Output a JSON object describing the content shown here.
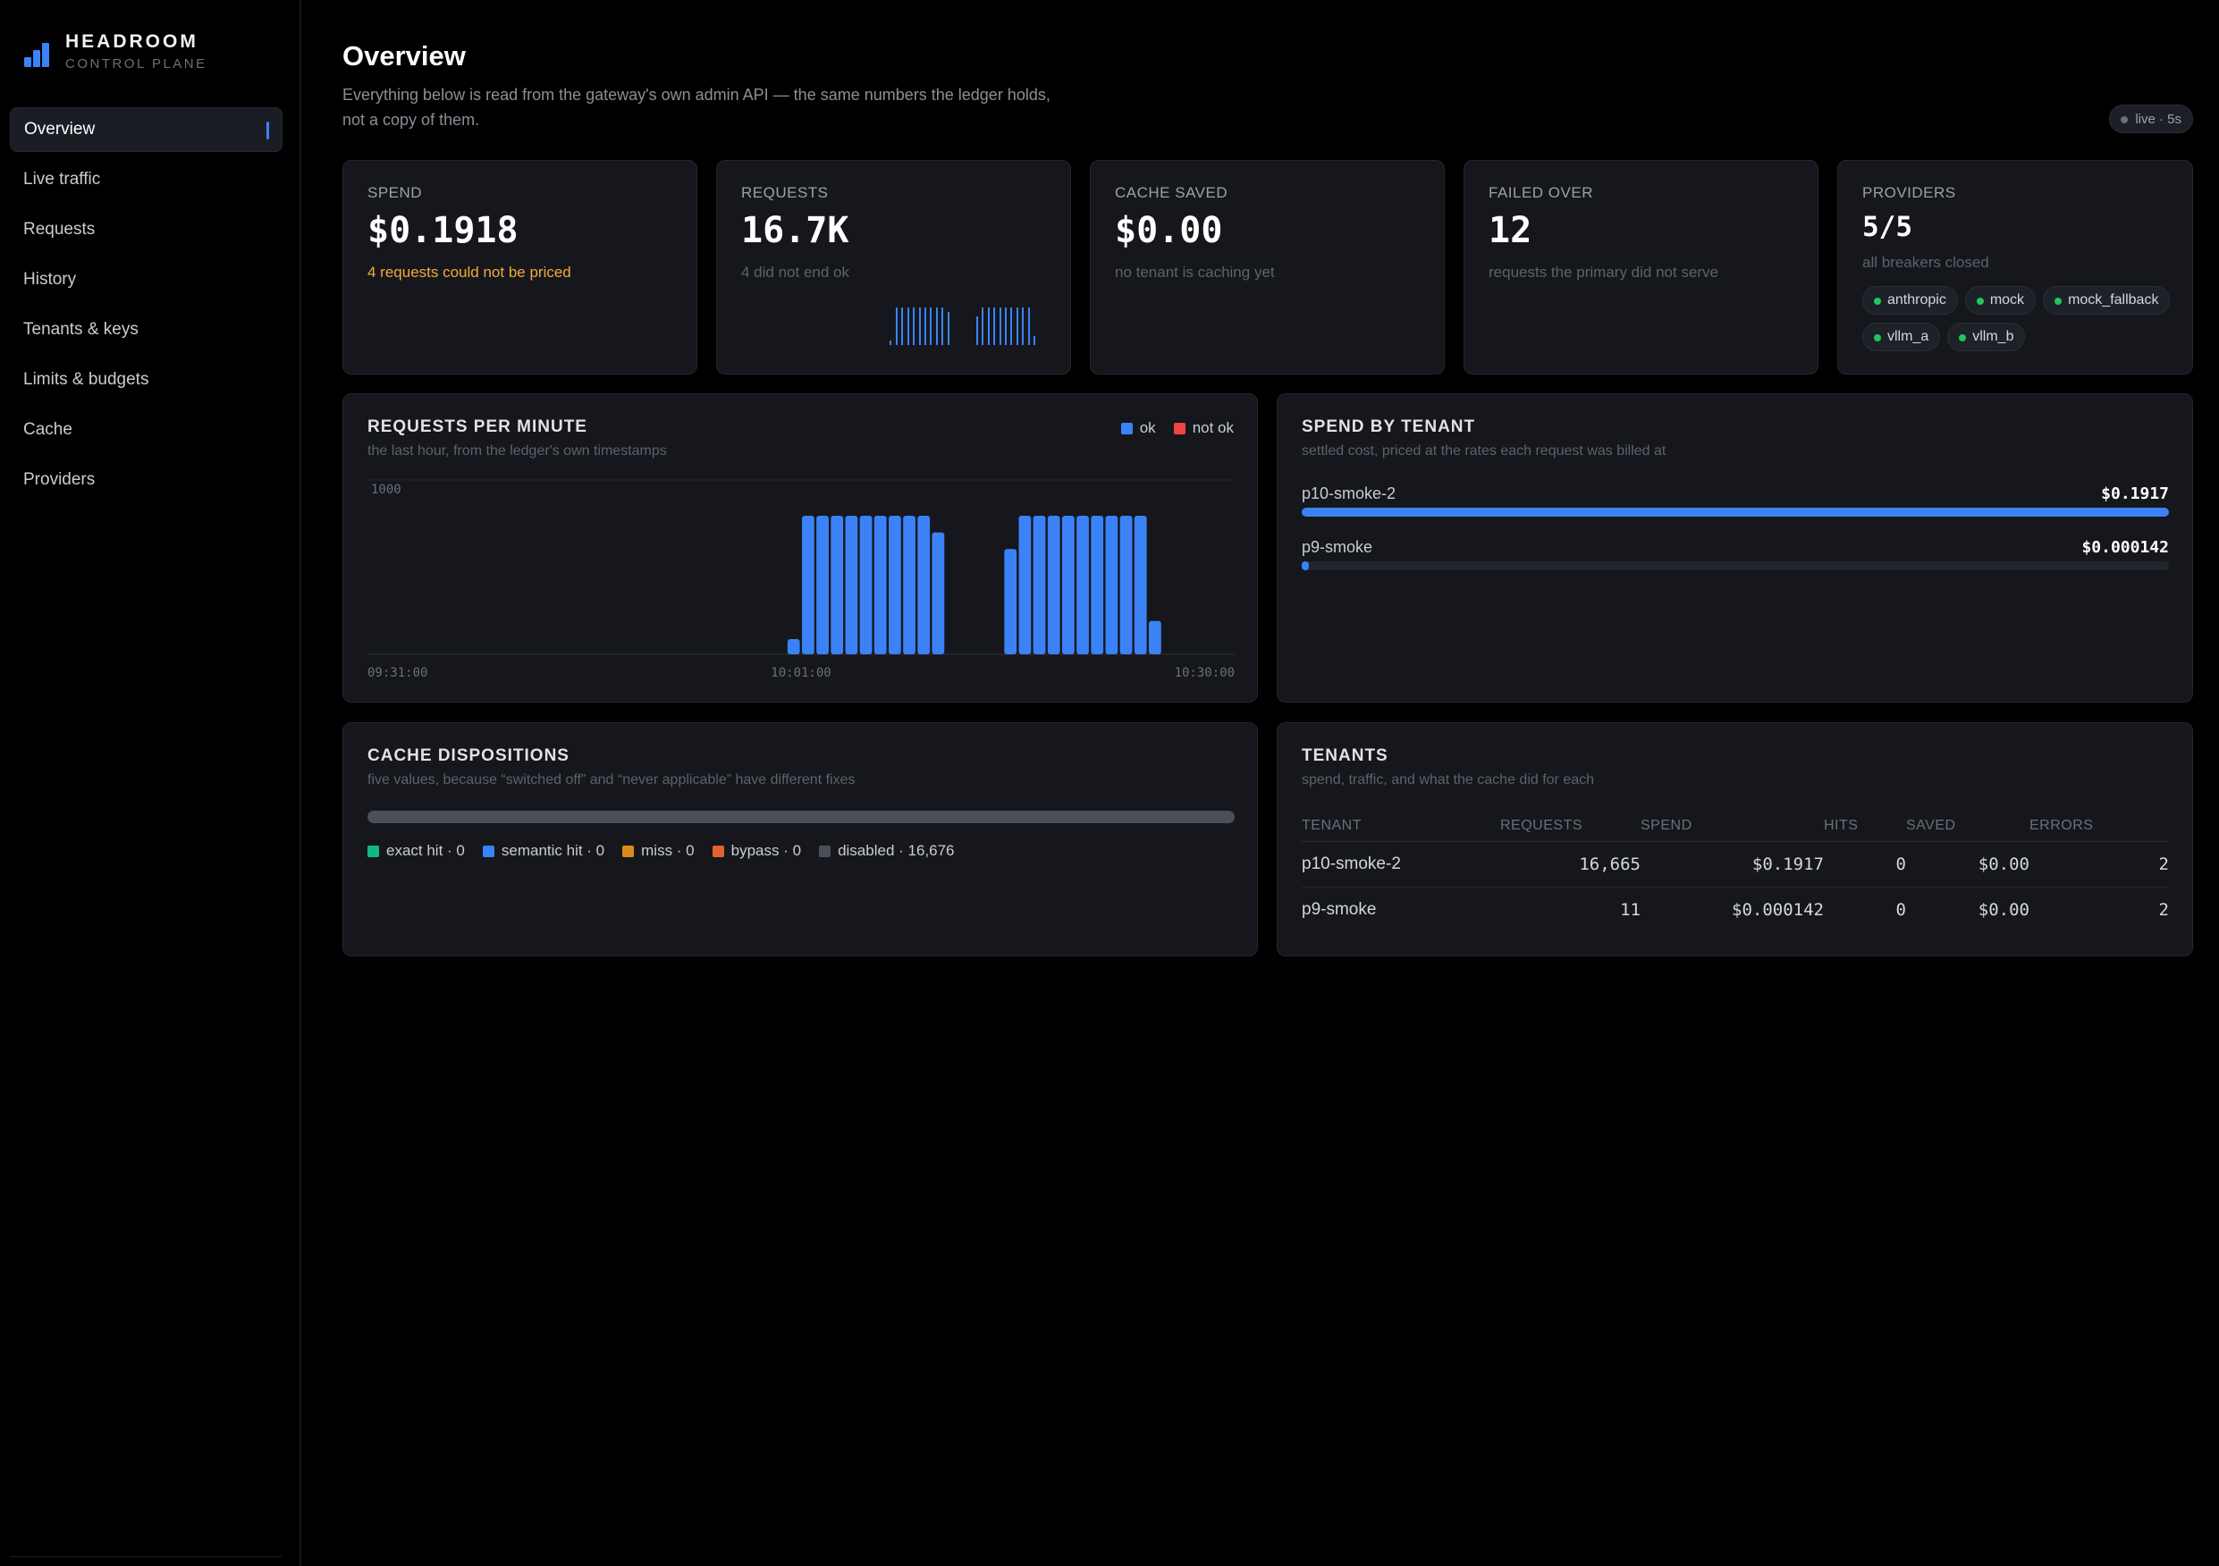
{
  "brand": {
    "name": "HEADROOM",
    "subtitle": "CONTROL PLANE",
    "icon": "bar-chart-icon"
  },
  "nav": {
    "items": [
      {
        "label": "Overview",
        "active": true
      },
      {
        "label": "Live traffic"
      },
      {
        "label": "Requests"
      },
      {
        "label": "History"
      },
      {
        "label": "Tenants & keys"
      },
      {
        "label": "Limits & budgets"
      },
      {
        "label": "Cache"
      },
      {
        "label": "Providers"
      }
    ]
  },
  "header": {
    "title": "Overview",
    "subtitle": "Everything below is read from the gateway's own admin API — the same numbers the ledger holds, not a copy of them.",
    "live": "live · 5s"
  },
  "stats": {
    "spend": {
      "label": "SPEND",
      "value": "$0.1918",
      "note": "4 requests could not be priced"
    },
    "requests": {
      "label": "REQUESTS",
      "value": "16.7K",
      "note": "4 did not end ok"
    },
    "cache_saved": {
      "label": "CACHE SAVED",
      "value": "$0.00",
      "note": "no tenant is caching yet"
    },
    "failed_over": {
      "label": "FAILED OVER",
      "value": "12",
      "note": "requests the primary did not serve"
    },
    "providers": {
      "label": "PROVIDERS",
      "value": "5/5",
      "note": "all breakers closed",
      "items": [
        "anthropic",
        "mock",
        "mock_fallback",
        "vllm_a",
        "vllm_b"
      ],
      "status_color": "#22c55e"
    }
  },
  "rpm_panel": {
    "title": "REQUESTS PER MINUTE",
    "subtitle": "the last hour, from the ledger's own timestamps",
    "legend": {
      "ok": "ok",
      "not_ok": "not ok"
    }
  },
  "chart_data": {
    "type": "bar",
    "title": "REQUESTS PER MINUTE",
    "x_tick_labels": [
      "09:31:00",
      "10:01:00",
      "10:30:00"
    ],
    "y_tick_labels": [
      "1000"
    ],
    "ylim": [
      0,
      1200
    ],
    "colors": {
      "ok": "#3b82f6",
      "not_ok": "#ef4444"
    },
    "series": [
      {
        "name": "ok",
        "values": [
          0,
          0,
          0,
          0,
          0,
          0,
          0,
          0,
          0,
          0,
          0,
          0,
          0,
          0,
          0,
          0,
          0,
          0,
          0,
          0,
          0,
          0,
          0,
          0,
          0,
          0,
          0,
          0,
          0,
          110,
          1000,
          1000,
          1000,
          1000,
          1000,
          1000,
          1000,
          1000,
          1000,
          880,
          0,
          0,
          0,
          0,
          760,
          1000,
          1000,
          1000,
          1000,
          1000,
          1000,
          1000,
          1000,
          1000,
          240,
          0,
          0,
          0,
          0,
          0
        ]
      },
      {
        "name": "not ok",
        "values": [
          0,
          0,
          0,
          0,
          0,
          0,
          0,
          0,
          0,
          0,
          0,
          0,
          0,
          0,
          0,
          0,
          0,
          0,
          0,
          0,
          0,
          0,
          0,
          0,
          0,
          0,
          0,
          0,
          0,
          0,
          0,
          0,
          0,
          0,
          0,
          0,
          0,
          0,
          0,
          0,
          0,
          0,
          0,
          0,
          0,
          0,
          0,
          0,
          0,
          0,
          0,
          0,
          0,
          0,
          0,
          0,
          0,
          0,
          0,
          0
        ]
      }
    ]
  },
  "spend_by_tenant": {
    "title": "SPEND BY TENANT",
    "subtitle": "settled cost, priced at the rates each request was billed at",
    "rows": [
      {
        "name": "p10-smoke-2",
        "value": "$0.1917",
        "fraction": 1.0
      },
      {
        "name": "p9-smoke",
        "value": "$0.000142",
        "fraction": 0.0074
      }
    ]
  },
  "cache_dispositions": {
    "title": "CACHE DISPOSITIONS",
    "subtitle": "five values, because “switched off” and “never applicable” have different fixes",
    "items": [
      {
        "label": "exact hit · 0",
        "color": "#10b981"
      },
      {
        "label": "semantic hit · 0",
        "color": "#3b82f6"
      },
      {
        "label": "miss · 0",
        "color": "#d98c1a"
      },
      {
        "label": "bypass · 0",
        "color": "#e2622e"
      },
      {
        "label": "disabled · 16,676",
        "color": "#4b4f57"
      }
    ]
  },
  "tenants_table": {
    "title": "TENANTS",
    "subtitle": "spend, traffic, and what the cache did for each",
    "headers": [
      "TENANT",
      "REQUESTS",
      "SPEND",
      "HITS",
      "SAVED",
      "ERRORS"
    ],
    "rows": [
      [
        "p10-smoke-2",
        "16,665",
        "$0.1917",
        "0",
        "$0.00",
        "2"
      ],
      [
        "p9-smoke",
        "11",
        "$0.000142",
        "0",
        "$0.00",
        "2"
      ]
    ]
  }
}
